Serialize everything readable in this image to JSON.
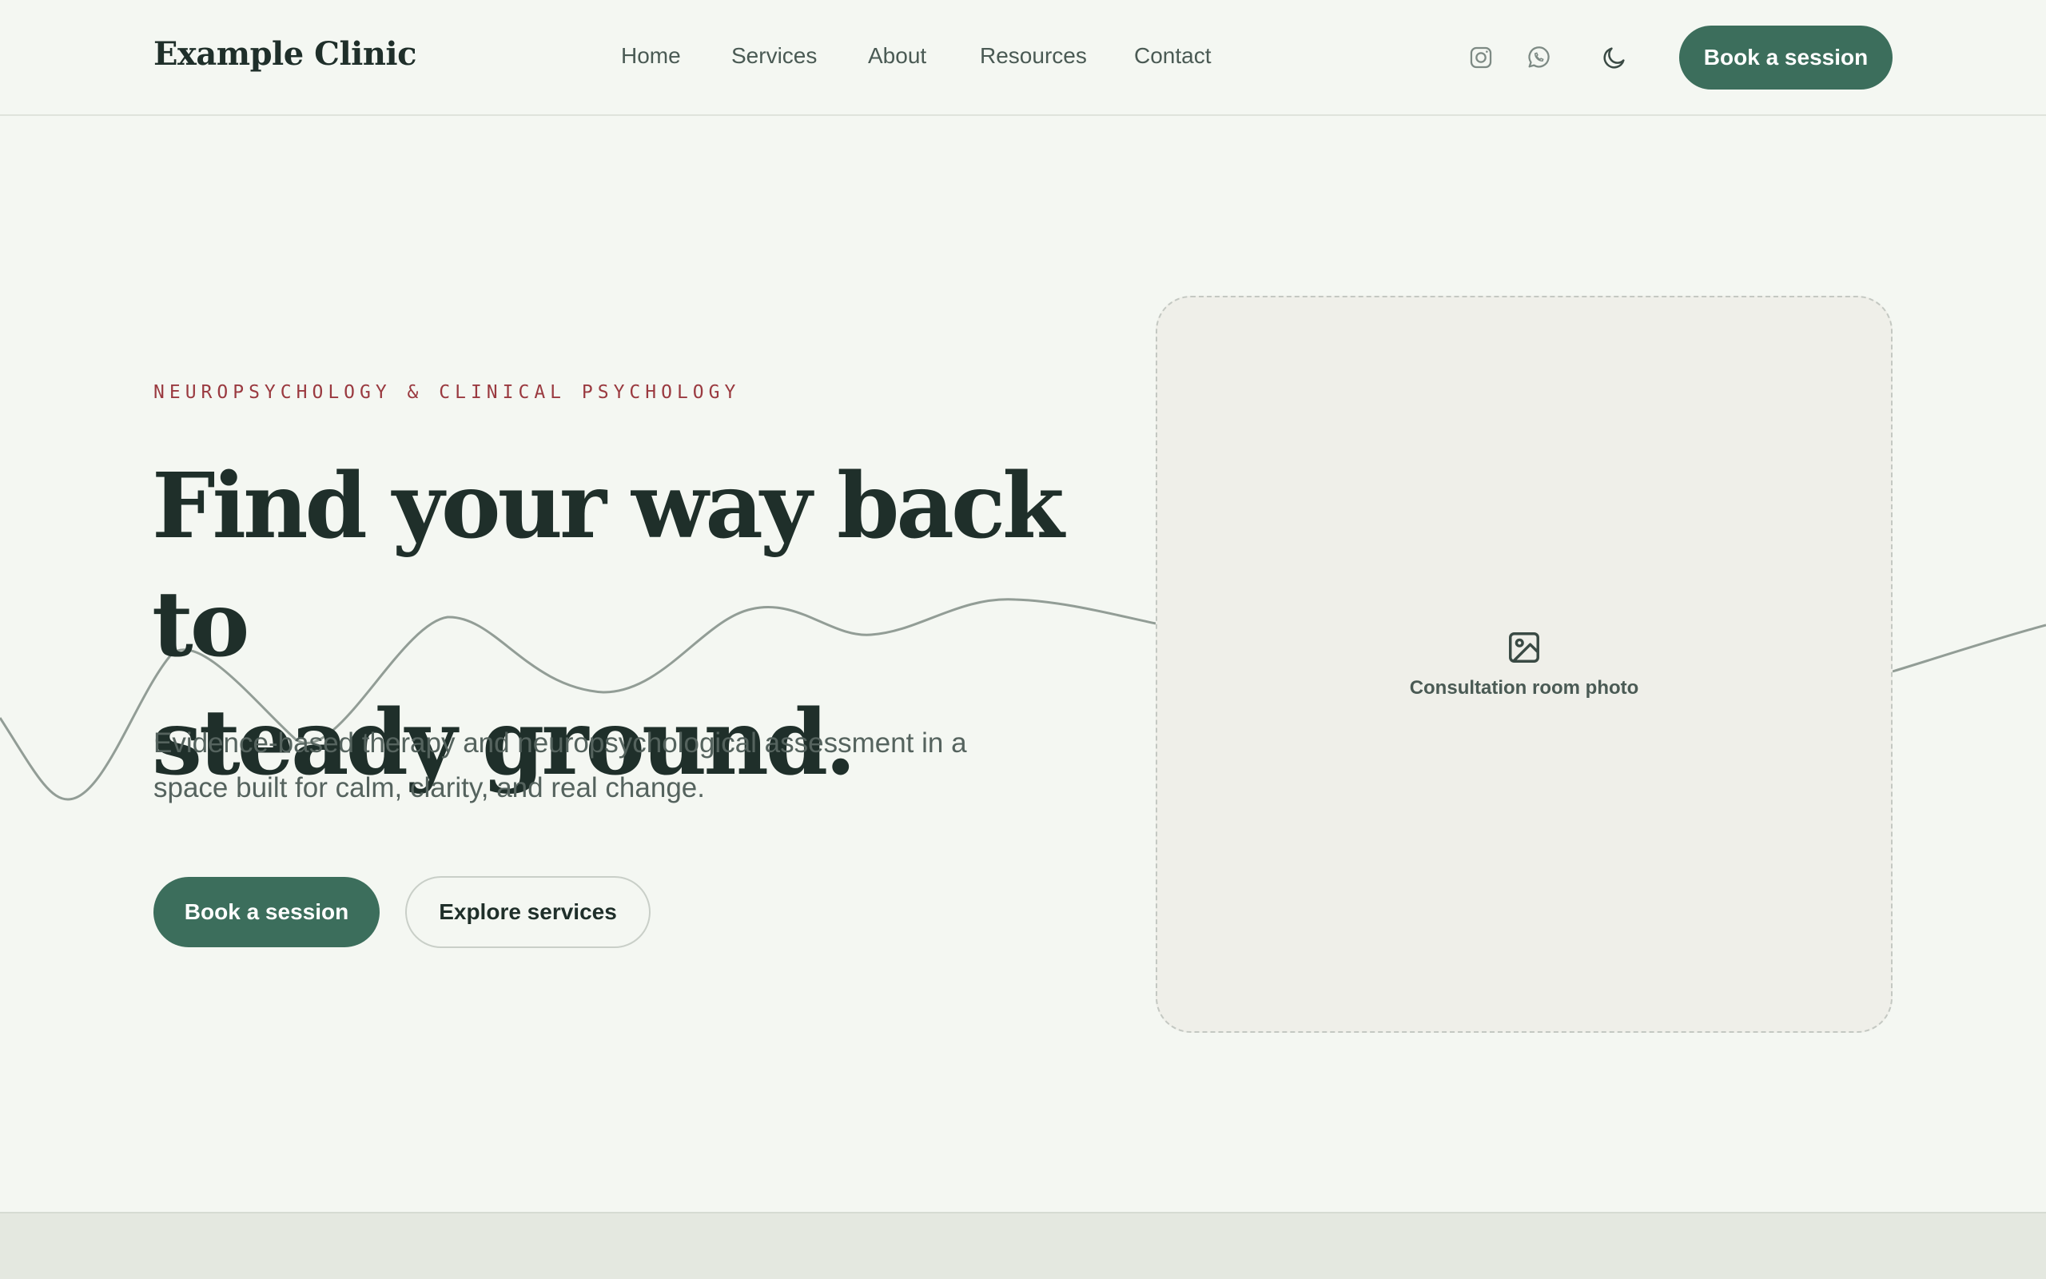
{
  "header": {
    "brand": "Example Clinic",
    "nav": [
      {
        "label": "Home"
      },
      {
        "label": "Services"
      },
      {
        "label": "About"
      },
      {
        "label": "Resources"
      },
      {
        "label": "Contact"
      }
    ],
    "social_icons": [
      "instagram-icon",
      "whatsapp-icon"
    ],
    "theme_toggle_icon": "moon-icon",
    "cta_label": "Book a session"
  },
  "hero": {
    "eyebrow": "NEUROPSYCHOLOGY & CLINICAL PSYCHOLOGY",
    "headline_line1": "Find your way back to",
    "headline_line2": "steady ground.",
    "subtext": "Evidence-based therapy and neuropsychological assessment in a space built for calm, clarity, and real change.",
    "primary_button": "Book a session",
    "secondary_button": "Explore services",
    "photo_placeholder": {
      "icon": "image-icon",
      "caption": "Consultation room photo"
    }
  },
  "colors": {
    "background": "#f4f7f2",
    "primary": "#3c6e5c",
    "eyebrow": "#9a3a40",
    "heading": "#1f2f2a",
    "body_text": "#55635e",
    "card_background": "#efefe9",
    "band": "#e4e8e0"
  }
}
